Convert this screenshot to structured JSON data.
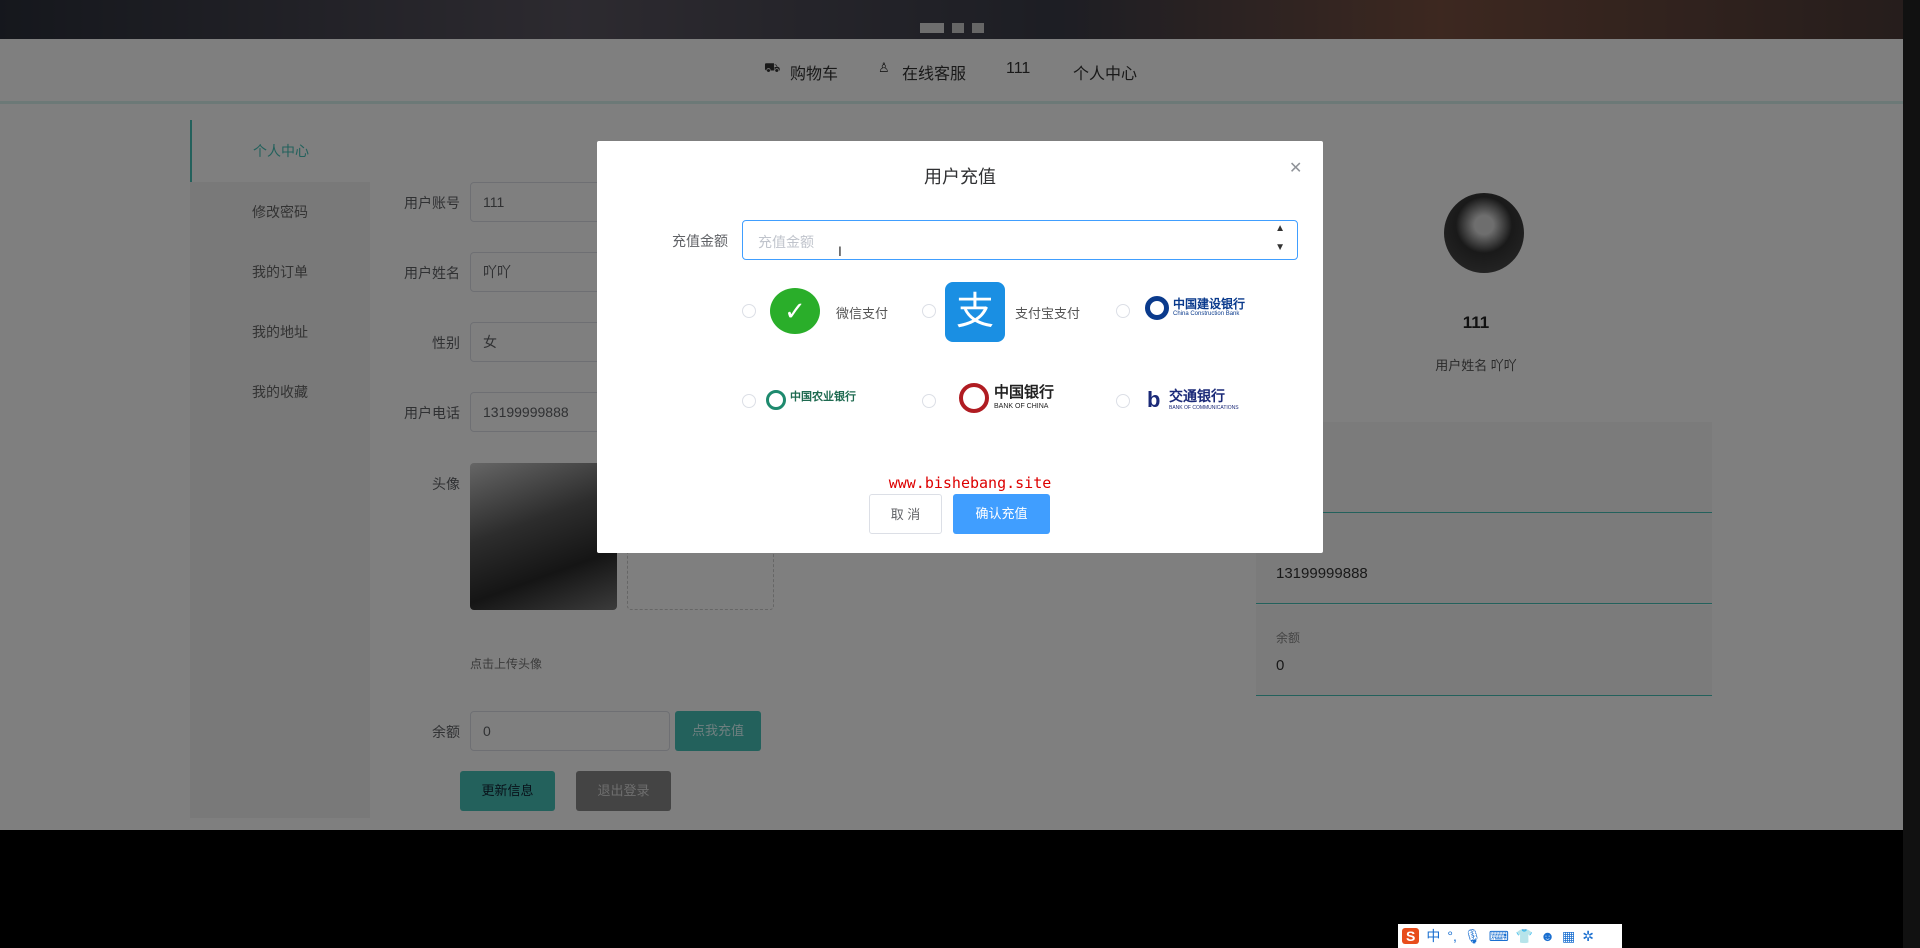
{
  "nav": {
    "cart": "购物车",
    "service": "在线客服",
    "user": "111",
    "center": "个人中心"
  },
  "sidebar": {
    "items": [
      "个人中心",
      "修改密码",
      "我的订单",
      "我的地址",
      "我的收藏"
    ]
  },
  "form": {
    "account_label": "用户账号",
    "account_value": "111",
    "name_label": "用户姓名",
    "name_value": "吖吖",
    "gender_label": "性别",
    "gender_value": "女",
    "phone_label": "用户电话",
    "phone_value": "13199999888",
    "avatar_label": "头像",
    "avatar_hint": "点击上传头像",
    "balance_label": "余额",
    "balance_value": "0",
    "recharge_button": "点我充值",
    "update_button": "更新信息",
    "logout_button": "退出登录"
  },
  "profile": {
    "username": "111",
    "name_line": "用户姓名 吖吖",
    "phone": "13199999888",
    "balance_label": "余额",
    "balance": "0"
  },
  "modal": {
    "title": "用户充值",
    "amount_label": "充值金额",
    "amount_placeholder": "充值金额",
    "payments": {
      "wechat": "微信支付",
      "alipay": "支付宝支付",
      "ccb": "中国建设银行",
      "ccb_en": "China Construction Bank",
      "abc": "中国农业银行",
      "boc": "中国银行",
      "boc_en": "BANK OF CHINA",
      "bocom": "交通银行",
      "bocom_en": "BANK OF COMMUNICATIONS"
    },
    "watermark": "www.bishebang.site",
    "cancel": "取 消",
    "confirm": "确认充值"
  },
  "ime": {
    "mode": "中"
  }
}
